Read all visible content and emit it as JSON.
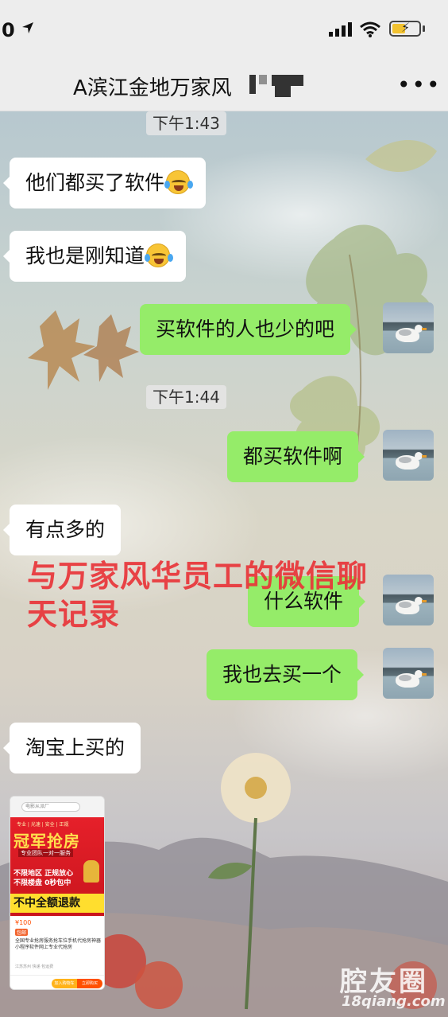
{
  "status_bar": {
    "time": "0",
    "icons": [
      "location-arrow-icon",
      "signal-icon",
      "wifi-icon",
      "battery-charging-icon"
    ]
  },
  "header": {
    "title": "A滨江金地万家风",
    "more_label": "•••"
  },
  "timestamps": [
    "下午1:43",
    "下午1:44"
  ],
  "messages": [
    {
      "side": "in",
      "text": "他们都买了软件"
    },
    {
      "side": "in",
      "text": "我也是刚知道"
    },
    {
      "side": "out",
      "text": "买软件的人也少的吧"
    },
    {
      "side": "out",
      "text": "都买软件啊"
    },
    {
      "side": "in",
      "text": "有点多的"
    },
    {
      "side": "out",
      "text": "什么软件"
    },
    {
      "side": "out",
      "text": "我也去买一个"
    },
    {
      "side": "in",
      "text": "淘宝上买的"
    }
  ],
  "overlay_caption": {
    "line1": "与万家风华员工的微信聊",
    "line2": "天记录"
  },
  "shared_image": {
    "search_text": "电影从派厂",
    "tags": "专业 | 光速 | 安全 | 正规",
    "headline": "冠军抢房",
    "subline": "专业团队一对一服务",
    "line1": "不限地区  正规放心",
    "line2": "不限楼盘  0秒包中",
    "strip": "不中全额退款",
    "price": "¥100",
    "tag": "包邮",
    "description": "全国专业抢房服务抢车位手机代抢房神器小程序软件网上专业代抢房",
    "meta": "江苏苏州  快递  包运费",
    "btn1": "加入购物车",
    "btn2": "立即购买"
  },
  "watermark": {
    "logo": "腔友圈",
    "url": "18qiang.com"
  },
  "colors": {
    "bubble_out": "#95ec69",
    "bubble_in": "#ffffff",
    "overlay_text": "#e83438",
    "header_bg": "#ededed"
  }
}
